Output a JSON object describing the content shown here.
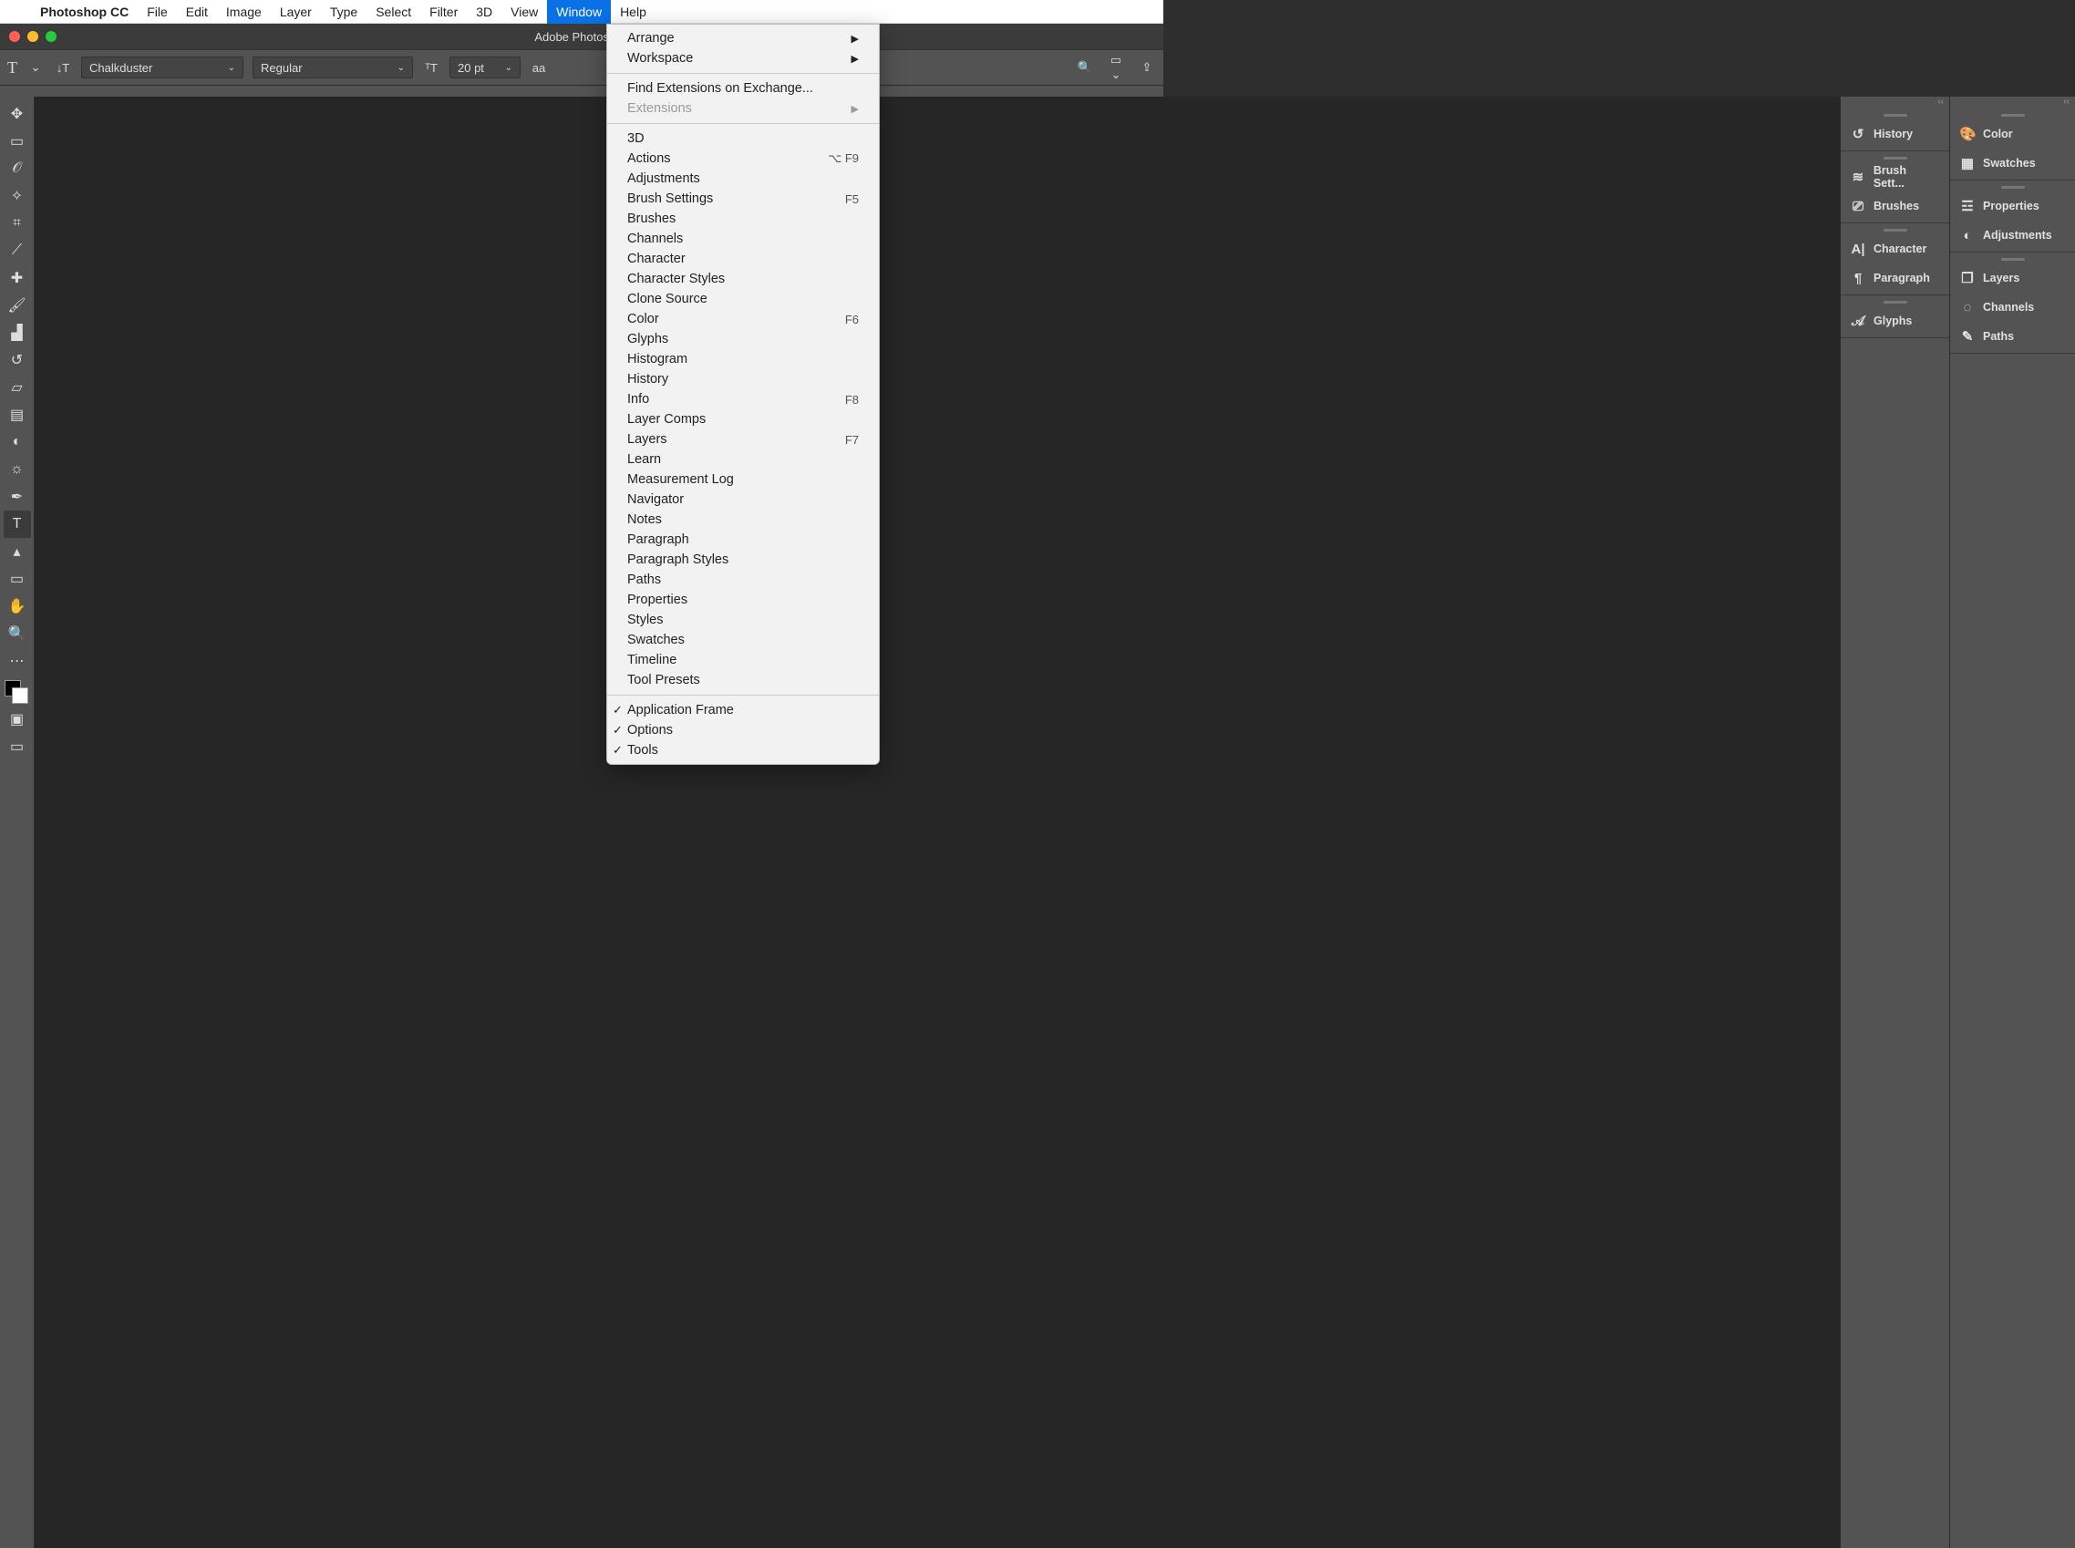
{
  "menubar": {
    "app": "Photoshop CC",
    "items": [
      "File",
      "Edit",
      "Image",
      "Layer",
      "Type",
      "Select",
      "Filter",
      "3D",
      "View",
      "Window",
      "Help"
    ],
    "selected": "Window"
  },
  "titlebar": {
    "title": "Adobe Photoshop"
  },
  "optbar": {
    "font": "Chalkduster",
    "style": "Regular",
    "size": "20 pt",
    "aa": "aa"
  },
  "window_menu": {
    "block1": [
      {
        "label": "Arrange",
        "submenu": true
      },
      {
        "label": "Workspace",
        "submenu": true
      }
    ],
    "block2": [
      {
        "label": "Find Extensions on Exchange..."
      },
      {
        "label": "Extensions",
        "submenu": true,
        "disabled": true
      }
    ],
    "block3": [
      {
        "label": "3D"
      },
      {
        "label": "Actions",
        "shortcut": "⌥ F9"
      },
      {
        "label": "Adjustments"
      },
      {
        "label": "Brush Settings",
        "shortcut": "F5"
      },
      {
        "label": "Brushes"
      },
      {
        "label": "Channels"
      },
      {
        "label": "Character"
      },
      {
        "label": "Character Styles"
      },
      {
        "label": "Clone Source"
      },
      {
        "label": "Color",
        "shortcut": "F6"
      },
      {
        "label": "Glyphs"
      },
      {
        "label": "Histogram"
      },
      {
        "label": "History"
      },
      {
        "label": "Info",
        "shortcut": "F8"
      },
      {
        "label": "Layer Comps"
      },
      {
        "label": "Layers",
        "shortcut": "F7"
      },
      {
        "label": "Learn"
      },
      {
        "label": "Measurement Log"
      },
      {
        "label": "Navigator"
      },
      {
        "label": "Notes"
      },
      {
        "label": "Paragraph"
      },
      {
        "label": "Paragraph Styles"
      },
      {
        "label": "Paths"
      },
      {
        "label": "Properties"
      },
      {
        "label": "Styles"
      },
      {
        "label": "Swatches"
      },
      {
        "label": "Timeline"
      },
      {
        "label": "Tool Presets"
      }
    ],
    "block4": [
      {
        "label": "Application Frame",
        "checked": true
      },
      {
        "label": "Options",
        "checked": true
      },
      {
        "label": "Tools",
        "checked": true
      }
    ]
  },
  "tools": [
    {
      "name": "move",
      "glyph": "✥"
    },
    {
      "name": "marquee",
      "glyph": "▭"
    },
    {
      "name": "lasso",
      "glyph": "𝒪"
    },
    {
      "name": "magic-wand",
      "glyph": "✧"
    },
    {
      "name": "crop",
      "glyph": "⌗"
    },
    {
      "name": "eyedropper",
      "glyph": "⟋"
    },
    {
      "name": "healing",
      "glyph": "✚"
    },
    {
      "name": "brush",
      "glyph": "🖌"
    },
    {
      "name": "stamp",
      "glyph": "▟"
    },
    {
      "name": "history-brush",
      "glyph": "↺"
    },
    {
      "name": "eraser",
      "glyph": "▱"
    },
    {
      "name": "gradient",
      "glyph": "▤"
    },
    {
      "name": "blur",
      "glyph": "◐"
    },
    {
      "name": "dodge",
      "glyph": "☼"
    },
    {
      "name": "pen",
      "glyph": "✒"
    },
    {
      "name": "type",
      "glyph": "T",
      "selected": true
    },
    {
      "name": "path-select",
      "glyph": "▴"
    },
    {
      "name": "rectangle",
      "glyph": "▭"
    },
    {
      "name": "hand",
      "glyph": "✋"
    },
    {
      "name": "zoom",
      "glyph": "🔍"
    },
    {
      "name": "more",
      "glyph": "⋯"
    }
  ],
  "panels": {
    "left": [
      {
        "group": [
          {
            "label": "History",
            "icon": "↺"
          }
        ]
      },
      {
        "group": [
          {
            "label": "Brush Sett...",
            "icon": "≋"
          },
          {
            "label": "Brushes",
            "icon": "⎚"
          }
        ]
      },
      {
        "group": [
          {
            "label": "Character",
            "icon": "A|"
          },
          {
            "label": "Paragraph",
            "icon": "¶"
          }
        ]
      },
      {
        "group": [
          {
            "label": "Glyphs",
            "icon": "𝒜"
          }
        ]
      }
    ],
    "right": [
      {
        "group": [
          {
            "label": "Color",
            "icon": "🎨"
          },
          {
            "label": "Swatches",
            "icon": "▦"
          }
        ]
      },
      {
        "group": [
          {
            "label": "Properties",
            "icon": "☲"
          },
          {
            "label": "Adjustments",
            "icon": "◐"
          }
        ]
      },
      {
        "group": [
          {
            "label": "Layers",
            "icon": "❒"
          },
          {
            "label": "Channels",
            "icon": "◌"
          },
          {
            "label": "Paths",
            "icon": "✎"
          }
        ]
      }
    ]
  }
}
